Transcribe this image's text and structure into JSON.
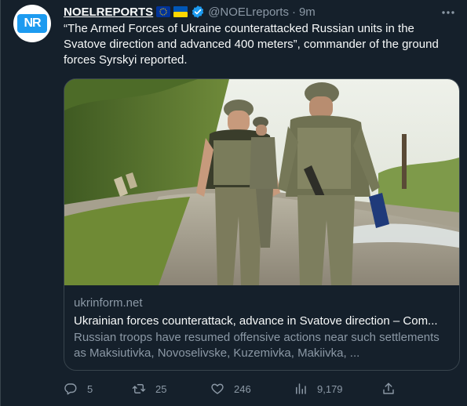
{
  "tweet": {
    "author_name": "NOELREPORTS",
    "handle": "@NOELreports",
    "separator": "·",
    "time": "9m",
    "avatar_text": "NR",
    "text": "“The Armed Forces of Ukraine counterattacked Russian units in the Svatove direction and advanced 400 meters”, commander of the ground forces Syrskyi reported."
  },
  "card": {
    "domain": "ukrinform.net",
    "title": "Ukrainian forces counterattack, advance in Svatove direction – Com...",
    "description": "Russian troops have resumed offensive actions near such settlements as Maksiutivka, Novoselivske, Kuzemivka, Makiivka, ..."
  },
  "actions": {
    "replies": "5",
    "retweets": "25",
    "likes": "246",
    "views": "9,179"
  },
  "icons": {
    "flag_eu": "eu-flag-icon",
    "flag_ua": "ukraine-flag-icon",
    "verified": "verified-badge-icon",
    "more": "more-icon",
    "reply": "reply-icon",
    "retweet": "retweet-icon",
    "like": "heart-icon",
    "views": "views-icon",
    "share": "share-icon"
  },
  "colors": {
    "background": "#15202b",
    "text_primary": "#f7f9f9",
    "text_secondary": "#8b98a5",
    "border": "#38444d",
    "accent": "#1d9bf0"
  }
}
